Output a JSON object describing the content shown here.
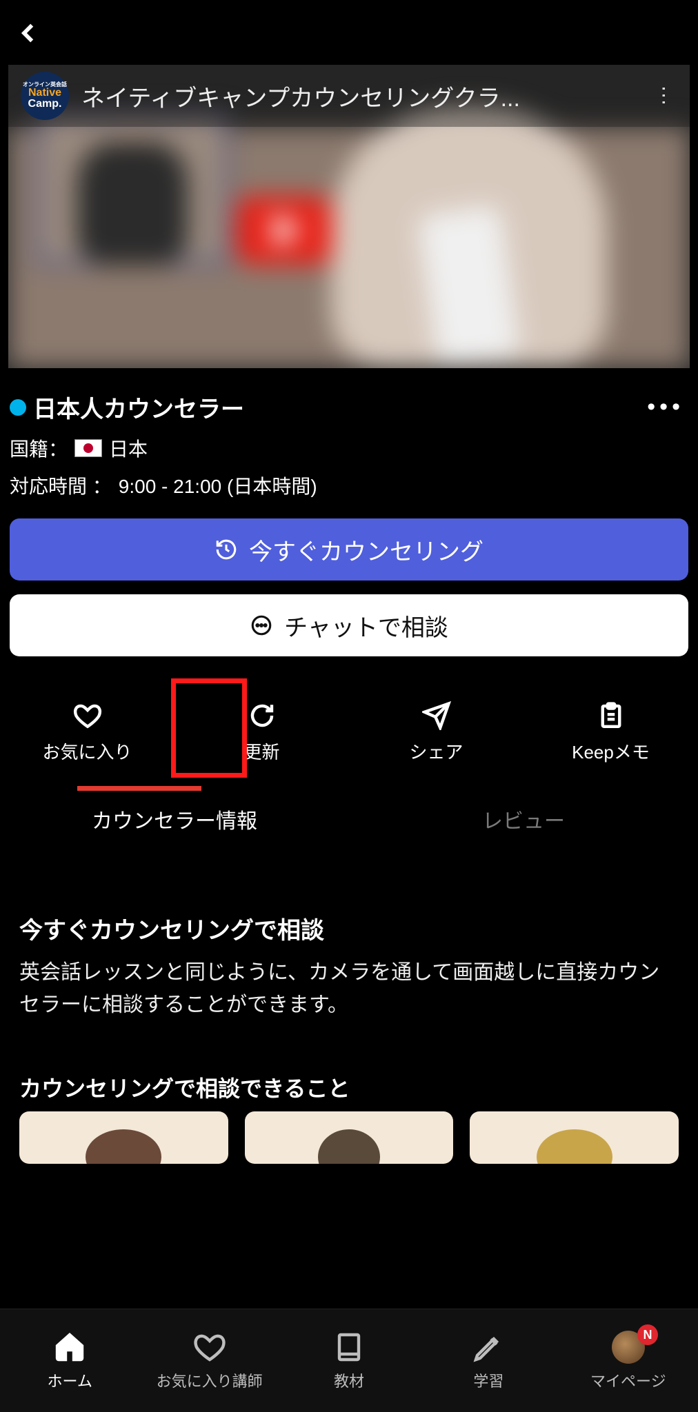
{
  "video": {
    "title": "ネイティブキャンプカウンセリングクラ...",
    "logo_line1": "Native",
    "logo_line2": "Camp.",
    "logo_tiny": "オンライン英会話"
  },
  "counselor": {
    "title": "日本人カウンセラー",
    "nationality_label": "国籍：",
    "nationality_value": "日本",
    "hours_label": "対応時間  ：",
    "hours_value": "9:00 - 21:00 (日本時間)"
  },
  "buttons": {
    "primary": "今すぐカウンセリング",
    "secondary": "チャットで相談"
  },
  "actions": {
    "favorite": "お気に入り",
    "refresh": "更新",
    "share": "シェア",
    "keep": "Keepメモ"
  },
  "tabs": {
    "info": "カウンセラー情報",
    "review": "レビュー"
  },
  "content": {
    "heading1": "今すぐカウンセリングで相談",
    "paragraph1": "英会話レッスンと同じように、カメラを通して画面越しに直接カウンセラーに相談することができます。",
    "heading2": "カウンセリングで相談できること"
  },
  "bottom_nav": {
    "home": "ホーム",
    "favorites": "お気に入り講師",
    "materials": "教材",
    "study": "学習",
    "mypage": "マイページ",
    "badge": "N"
  }
}
